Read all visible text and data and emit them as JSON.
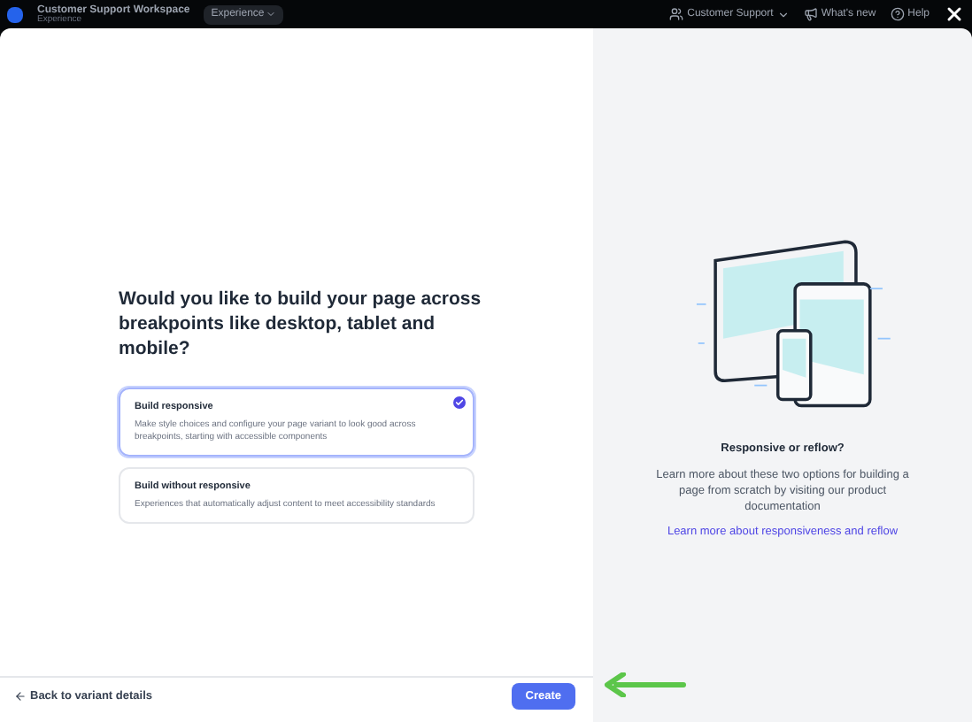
{
  "top_bar": {
    "app_title": "Customer Support Workspace",
    "app_subtitle": "Experience",
    "context_menu": "Experience",
    "items": [
      {
        "kind": "dropdown",
        "label": "Customer Support"
      },
      {
        "kind": "news",
        "label": "What's new"
      },
      {
        "kind": "help",
        "label": "Help"
      }
    ]
  },
  "question": "Would you like to build your page across breakpoints like desktop, tablet and mobile?",
  "options": [
    {
      "title": "Build responsive",
      "description": "Make style choices and configure your page variant to look good across breakpoints, starting with accessible components",
      "selected": true
    },
    {
      "title": "Build without responsive",
      "description": "Experiences that automatically adjust content to meet accessibility standards",
      "selected": false
    }
  ],
  "info": {
    "title": "Responsive or reflow?",
    "text": "Learn more about these two options for building a page from scratch by visiting our product documentation",
    "link": "Learn more about responsiveness and reflow"
  },
  "footer": {
    "back": "Back to variant details",
    "create": "Create"
  }
}
